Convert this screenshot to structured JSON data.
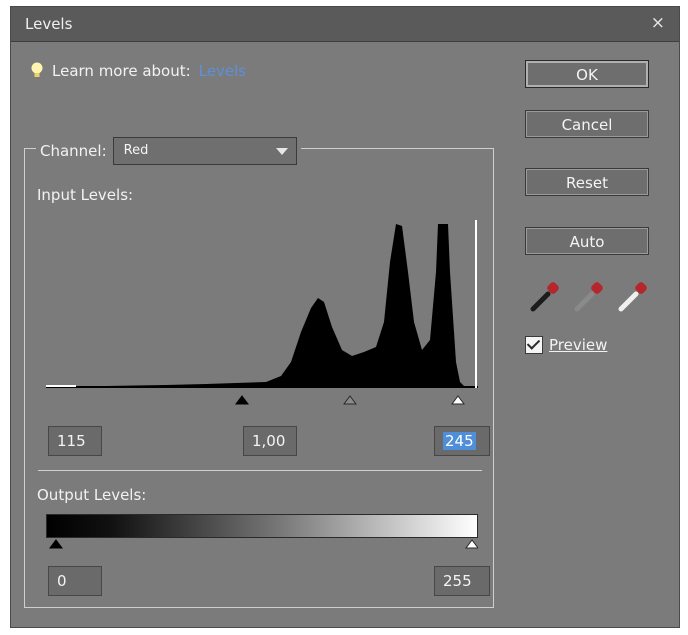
{
  "window": {
    "title": "Levels",
    "close_glyph": "×"
  },
  "learn_more": {
    "prefix": "Learn more about:",
    "link": "Levels"
  },
  "buttons": {
    "ok": "OK",
    "cancel": "Cancel",
    "reset": "Reset",
    "auto": "Auto"
  },
  "channel": {
    "label": "Channel:",
    "selected": "Red"
  },
  "input_levels": {
    "label": "Input Levels:",
    "black": "115",
    "gamma": "1,00",
    "white": "245",
    "slider_values": {
      "black": 115,
      "gamma": 180,
      "white": 245
    }
  },
  "output_levels": {
    "label": "Output Levels:",
    "black": "0",
    "white": "255",
    "slider_values": {
      "black": 0,
      "white": 255
    }
  },
  "preview": {
    "label": "Preview",
    "checked": true
  },
  "eyedroppers": [
    "black-point-eyedropper-icon",
    "gray-point-eyedropper-icon",
    "white-point-eyedropper-icon"
  ],
  "colors": {
    "dialog": "#7b7b7b",
    "link": "#5d90d8",
    "selection": "#4f8ed8",
    "dropper_red": "#b6262b"
  }
}
